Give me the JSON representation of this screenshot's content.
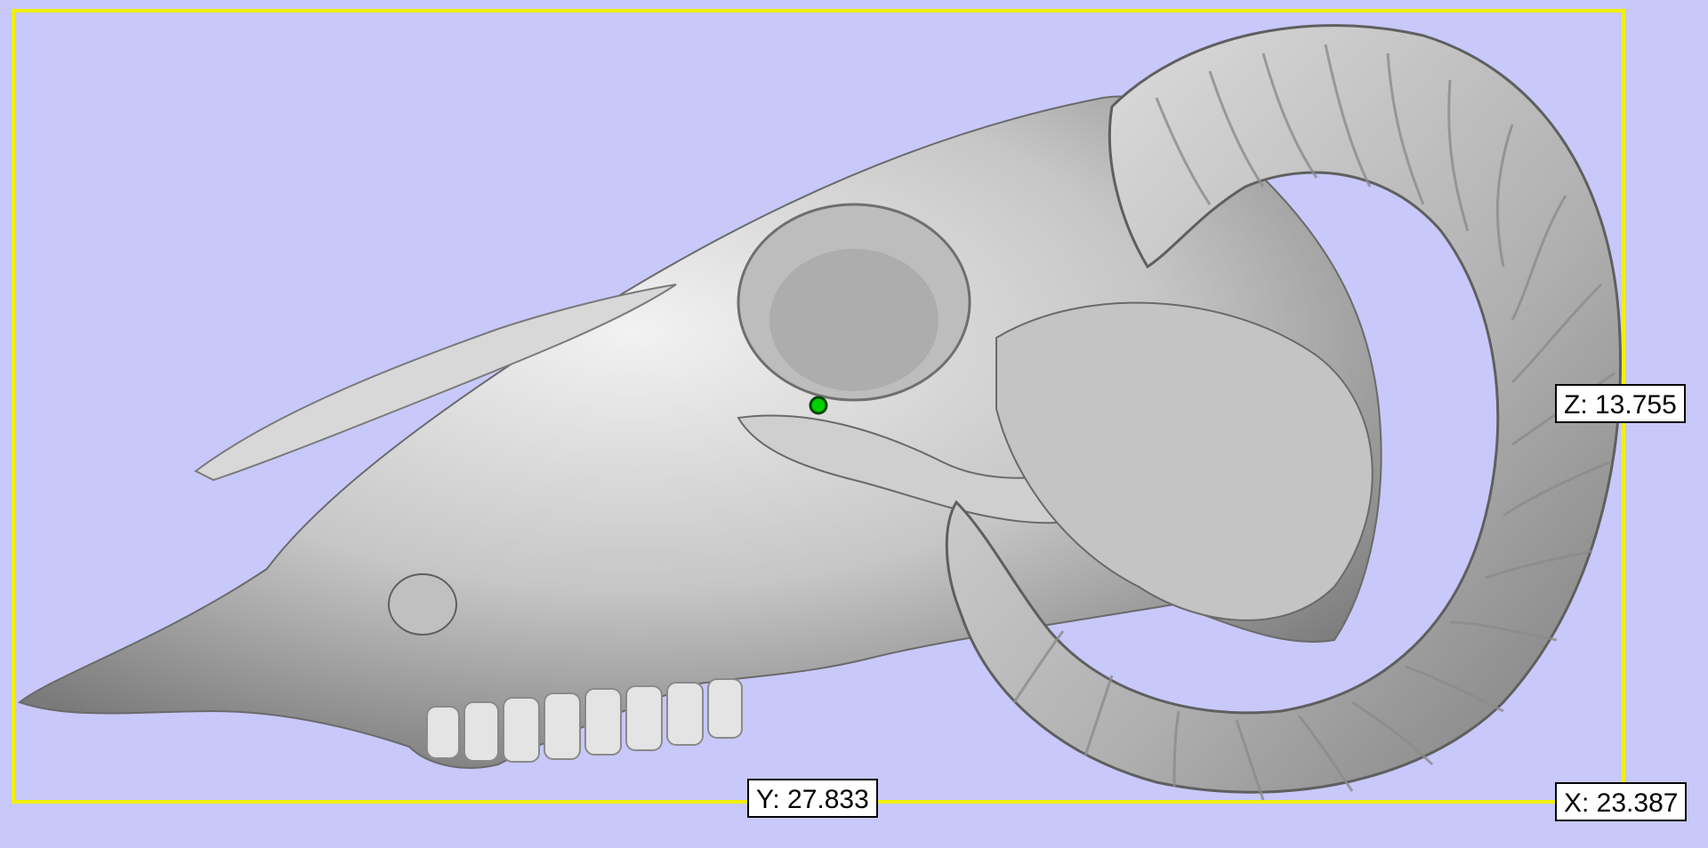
{
  "viewport": {
    "background": "#c8c8fa",
    "bounding_box_color": "#ffff00",
    "model_color": "#b4b4b4",
    "marker_color": "#00d000",
    "model": "ram-skull"
  },
  "dimensions": {
    "x_label": "X: 23.387",
    "y_label": "Y: 27.833",
    "z_label": "Z: 13.755"
  }
}
